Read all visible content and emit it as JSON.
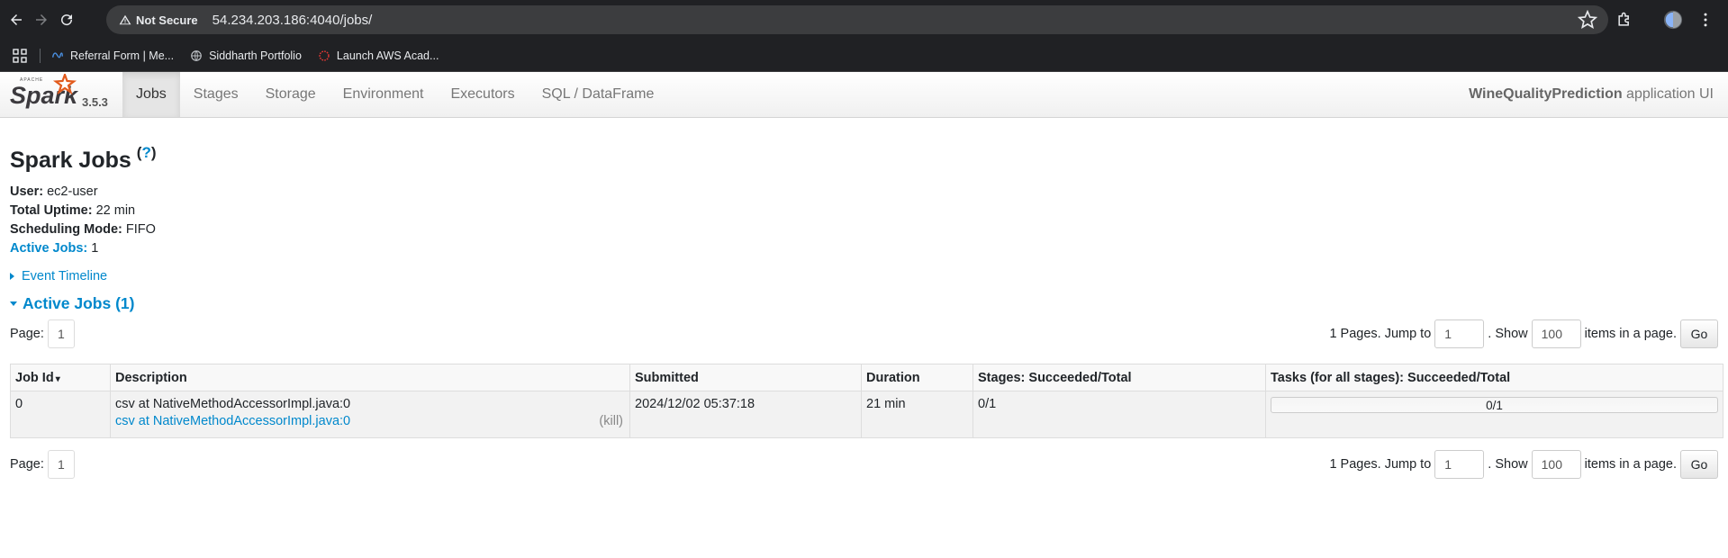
{
  "browser": {
    "security_label": "Not Secure",
    "url": "54.234.203.186:4040/jobs/",
    "bookmarks": [
      {
        "label": "Referral Form | Me...",
        "icon": "meta-icon"
      },
      {
        "label": "Siddharth Portfolio",
        "icon": "globe-icon"
      },
      {
        "label": "Launch AWS Acad...",
        "icon": "aws-academy-icon"
      }
    ]
  },
  "spark_nav": {
    "version": "3.5.3",
    "tabs": [
      {
        "label": "Jobs",
        "active": true
      },
      {
        "label": "Stages",
        "active": false
      },
      {
        "label": "Storage",
        "active": false
      },
      {
        "label": "Environment",
        "active": false
      },
      {
        "label": "Executors",
        "active": false
      },
      {
        "label": "SQL / DataFrame",
        "active": false
      }
    ],
    "app_name": "WineQualityPrediction",
    "app_suffix": " application UI"
  },
  "page": {
    "title": "Spark Jobs",
    "help_open": "(",
    "help_q": "?",
    "help_close": ")",
    "summary": {
      "user_label": "User:",
      "user_value": " ec2-user",
      "uptime_label": "Total Uptime:",
      "uptime_value": " 22 min",
      "mode_label": "Scheduling Mode:",
      "mode_value": " FIFO",
      "active_label": "Active Jobs:",
      "active_value": " 1"
    },
    "event_timeline": "Event Timeline",
    "active_jobs_heading": "Active Jobs (1)"
  },
  "pager": {
    "page_label": "Page:",
    "current_page": "1",
    "pages_text": "1 Pages. Jump to",
    "jump_value": "1",
    "show_text": ". Show",
    "show_value": "100",
    "items_text": "items in a page.",
    "go_label": "Go"
  },
  "table": {
    "headers": [
      "Job Id",
      "Description",
      "Submitted",
      "Duration",
      "Stages: Succeeded/Total",
      "Tasks (for all stages): Succeeded/Total"
    ],
    "sort_indicator": "▾",
    "rows": [
      {
        "job_id": "0",
        "description": "csv at NativeMethodAccessorImpl.java:0",
        "description_link": "csv at NativeMethodAccessorImpl.java:0",
        "kill": "(kill)",
        "submitted": "2024/12/02 05:37:18",
        "duration": "21 min",
        "stages": "0/1",
        "tasks": "0/1",
        "tasks_progress": 0
      }
    ]
  },
  "colors": {
    "link": "#0088cc",
    "chrome_bg": "#202124",
    "omnibox_bg": "#3c3d3f",
    "spark_orange": "#e25a1c"
  }
}
